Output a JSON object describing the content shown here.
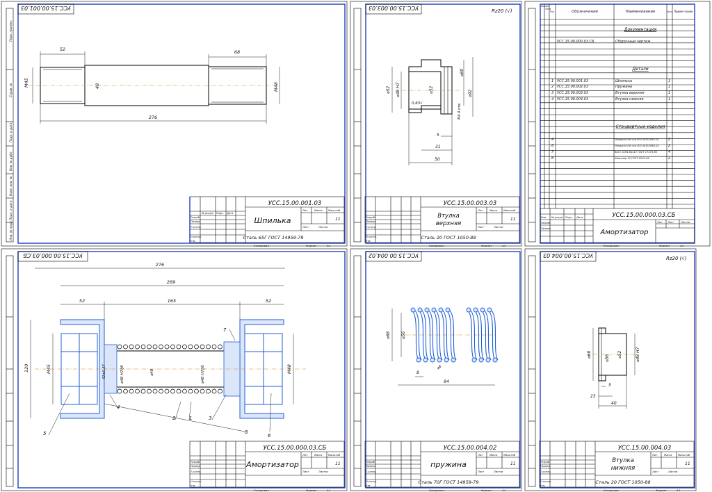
{
  "sheets": {
    "stud": {
      "code_top": "УСС.15.00.001.03",
      "code": "УСС.15.00.001.03",
      "name": "Шпилька",
      "material": "Сталь 65Г ГОСТ 14959-79",
      "sheet_count": "11",
      "dims": {
        "left_len": "52",
        "right_len": "68",
        "total": "276",
        "d_left": "М45",
        "d_mid": "48",
        "d_right": "М48"
      }
    },
    "upper_bush": {
      "code_top": "УСС.15.00.003.03",
      "code": "УСС.15.00.003.03",
      "name_line1": "Втулка",
      "name_line2": "верхняя",
      "material": "Сталь 20 ГОСТ 1050-88",
      "sheet_count": "11",
      "roughness": "Rz20 (√)",
      "dims": {
        "d52": "⌀52",
        "d48": "⌀48 H7",
        "d52b": "⌀52",
        "d80": "⌀80",
        "d92": "⌀92",
        "holes": "М4 4 отв.",
        "rough": "0,63√",
        "w5": "5",
        "w31": "31",
        "w50": "50"
      }
    },
    "spec": {
      "header": {
        "format": "Формат",
        "zone": "Зона",
        "pos": "Поз.",
        "designation": "Обозначение",
        "name": "Наименование",
        "qty": "Кол.",
        "note": "Приме-чание"
      },
      "section_docs": "Документация",
      "section_parts": "Детали",
      "section_std": "Стандартные изделия",
      "docs": [
        {
          "designation": "УСС.15.00.000.03.СБ",
          "name": "Сборочный чертеж"
        }
      ],
      "parts": [
        {
          "pos": "1",
          "designation": "УСС.15.00.001.03",
          "name": "Шпилька",
          "qty": "1"
        },
        {
          "pos": "2",
          "designation": "УСС.15.00.002.03",
          "name": "Пружина",
          "qty": "1"
        },
        {
          "pos": "3",
          "designation": "УСС.15.00.003.03",
          "name": "Втулка верхняя",
          "qty": "1"
        },
        {
          "pos": "4",
          "designation": "УСС.15.00.004.03",
          "name": "Втулка нижняя",
          "qty": "1"
        }
      ],
      "std": [
        {
          "pos": "4",
          "name": "Hexagon thin nut ISO 4035-M45-04",
          "qty": "2"
        },
        {
          "pos": "6",
          "name": "Hexagon thin nut ISO 4035-M48-04",
          "qty": "2"
        },
        {
          "pos": "7",
          "name": "Винт А.М4-6gх12 ГОСТ 17473-80",
          "qty": "4"
        },
        {
          "pos": "8",
          "name": "Швеллер 12 ГОСТ 8240-89",
          "qty": "2"
        }
      ],
      "code": "УСС.15.00.000.03.СБ",
      "name": "Амортизатор"
    },
    "assembly": {
      "code_top": "УСС.15.00.000.03.СБ",
      "code": "УСС.15.00.000.03.СБ",
      "name": "Амортизатор",
      "sheet_count": "11",
      "dims": {
        "total": "276",
        "inner": "269",
        "left": "52",
        "mid": "165",
        "right": "52",
        "h120": "120",
        "m45": "М45",
        "m48": "М48",
        "d42": "42±0,37",
        "fit1": "⌀48 H7/j6",
        "d48": "⌀48",
        "fit2": "⌀48 H7/j6"
      },
      "balloons": [
        "1",
        "2",
        "3",
        "4",
        "5",
        "6",
        "7",
        "8"
      ]
    },
    "spring": {
      "code_top": "УСС.15.00.004.02",
      "code": "УСС.15.00.004.02",
      "name": "пружина",
      "material": "Сталь 70Г ГОСТ 14959-79",
      "sheet_count": "11",
      "dims": {
        "d68": "⌀68",
        "d56": "⌀56",
        "p8": "8",
        "d6": "⌀6",
        "l94": "94"
      }
    },
    "lower_bush": {
      "code_top": "УСС.15.00.004.03",
      "code": "УСС.15.00.004.03",
      "name_line1": "Втулка",
      "name_line2": "нижняя",
      "material": "Сталь 20 ГОСТ 1050-88",
      "sheet_count": "11",
      "roughness": "Rz20 (√)",
      "dims": {
        "d68": "⌀68",
        "d56": "⌀56",
        "d52": "⌀52",
        "d48": "⌀48 H7",
        "w5": "5",
        "w23": "23",
        "w40": "40"
      }
    }
  },
  "title_block": {
    "izm": "Изм.",
    "list": "Лист",
    "ndoc": "№ докум.",
    "sign": "Подп.",
    "date": "Дата",
    "razrab": "Разраб.",
    "prov": "Провер.",
    "tkontr": "Т.контр.",
    "nkontr": "Н.контр.",
    "utv": "Утв.",
    "lit": "Лит.",
    "mass": "Масса",
    "scale": "Масштаб",
    "sheet": "Лист",
    "sheets": "Листов",
    "copied": "Копировал",
    "format": "Формат",
    "format_val": "А4"
  },
  "side_strip": [
    "Перв. примен.",
    "Справ. №",
    "Подп. и дата",
    "Инв. № дубл.",
    "Взам. инв. №",
    "Подп. и дата",
    "Инв. № подл."
  ]
}
